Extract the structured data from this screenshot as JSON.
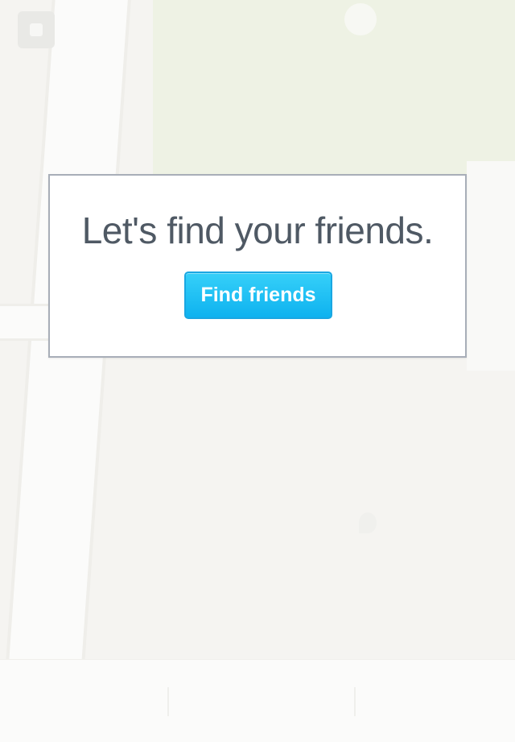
{
  "map": {
    "label_top": "",
    "label_bottom": ""
  },
  "bottom_bar": {
    "tabs": [
      "",
      "",
      ""
    ]
  },
  "dialog": {
    "title": "Let's find your friends.",
    "button_label": "Find friends",
    "button_color": "#15b9f2"
  }
}
